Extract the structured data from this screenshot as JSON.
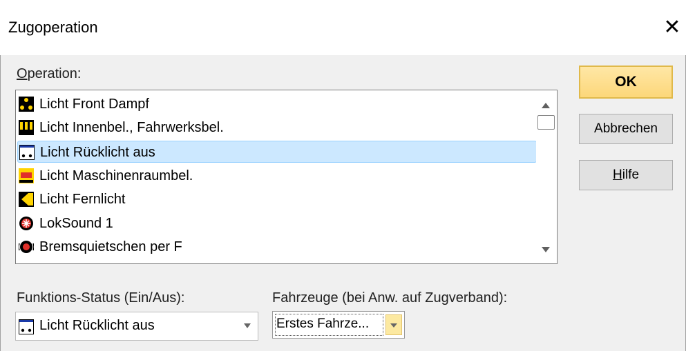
{
  "window": {
    "title": "Zugoperation",
    "close_glyph": "✕"
  },
  "operation_label": {
    "prefix": "",
    "underlined": "O",
    "rest": "peration:"
  },
  "operations": [
    {
      "icon": "light-front-steam-icon",
      "label": "Licht Front Dampf",
      "selected": false
    },
    {
      "icon": "interior-light-icon",
      "label": "Licht Innenbel., Fahrwerksbel.",
      "selected": false
    },
    {
      "icon": "taillight-off-icon",
      "label": "Licht Rücklicht aus",
      "selected": true
    },
    {
      "icon": "engine-room-light-icon",
      "label": "Licht Maschinenraumbel.",
      "selected": false
    },
    {
      "icon": "high-beam-icon",
      "label": "Licht Fernlicht",
      "selected": false
    },
    {
      "icon": "loksound-icon",
      "label": "LokSound 1",
      "selected": false
    },
    {
      "icon": "brake-squeal-icon",
      "label": "Bremsquietschen per F",
      "selected": false
    }
  ],
  "buttons": {
    "ok": "OK",
    "cancel": "Abbrechen",
    "help": {
      "underlined": "H",
      "rest": "ilfe"
    }
  },
  "function_status": {
    "label": "Funktions-Status (Ein/Aus):",
    "value": "Licht Rücklicht aus",
    "icon": "taillight-off-icon"
  },
  "vehicles": {
    "label": "Fahrzeuge (bei Anw. auf Zugverband):",
    "value": "Erstes Fahrze..."
  },
  "colors": {
    "selection_bg": "#cce8ff",
    "ok_button": "#fcd77a"
  }
}
